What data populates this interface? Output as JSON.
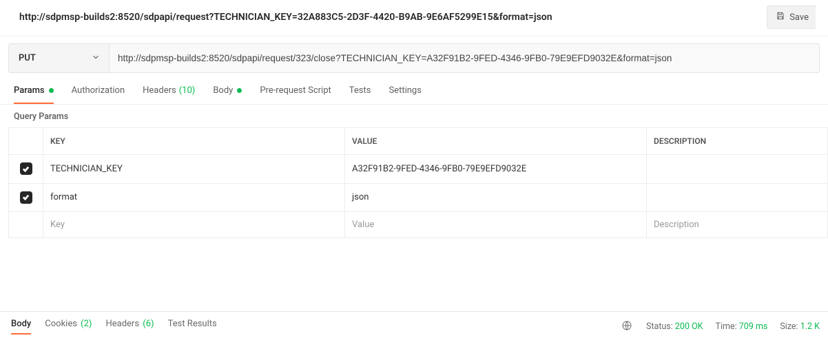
{
  "request_name": "http://sdpmsp-builds2:8520/sdpapi/request?TECHNICIAN_KEY=32A883C5-2D3F-4420-B9AB-9E6AF5299E15&format=json",
  "save_label": "Save",
  "method": "PUT",
  "url": "http://sdpmsp-builds2:8520/sdpapi/request/323/close?TECHNICIAN_KEY=A32F91B2-9FED-4346-9FB0-79E9EFD9032E&format=json",
  "tabs": {
    "params": "Params",
    "authorization": "Authorization",
    "headers": "Headers",
    "headers_count": "(10)",
    "body": "Body",
    "prerequest": "Pre-request Script",
    "tests": "Tests",
    "settings": "Settings"
  },
  "query_params_heading": "Query Params",
  "columns": {
    "key": "KEY",
    "value": "VALUE",
    "description": "DESCRIPTION"
  },
  "rows": [
    {
      "key": "TECHNICIAN_KEY",
      "value": "A32F91B2-9FED-4346-9FB0-79E9EFD9032E"
    },
    {
      "key": "format",
      "value": "json"
    }
  ],
  "placeholders": {
    "key": "Key",
    "value": "Value",
    "description": "Description"
  },
  "response": {
    "tabs": {
      "body": "Body",
      "cookies": "Cookies",
      "cookies_count": "(2)",
      "headers": "Headers",
      "headers_count": "(6)",
      "test_results": "Test Results"
    },
    "status_label": "Status:",
    "status_value": "200 OK",
    "time_label": "Time:",
    "time_value": "709 ms",
    "size_label": "Size:",
    "size_value": "1.2 K"
  }
}
